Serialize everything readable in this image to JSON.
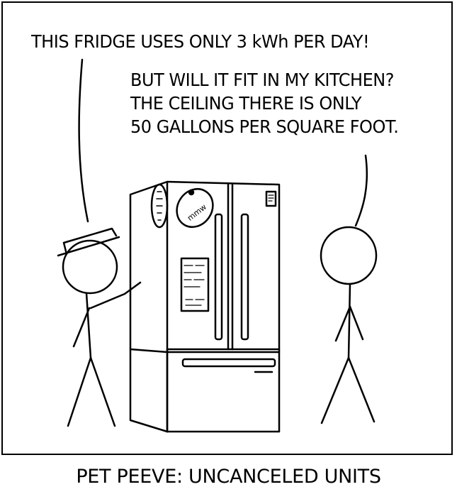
{
  "comic": {
    "caption": "PET PEEVE: UNCANCELED UNITS",
    "dialogue": {
      "left_character": "THIS FRIDGE USES ONLY 3 kWh PER DAY!",
      "right_character_lines": [
        "BUT WILL IT FIT IN MY KITCHEN?",
        "THE CEILING THERE IS ONLY",
        "50 GALLONS PER SQUARE FOOT."
      ]
    },
    "magnet_text": "mmw"
  }
}
